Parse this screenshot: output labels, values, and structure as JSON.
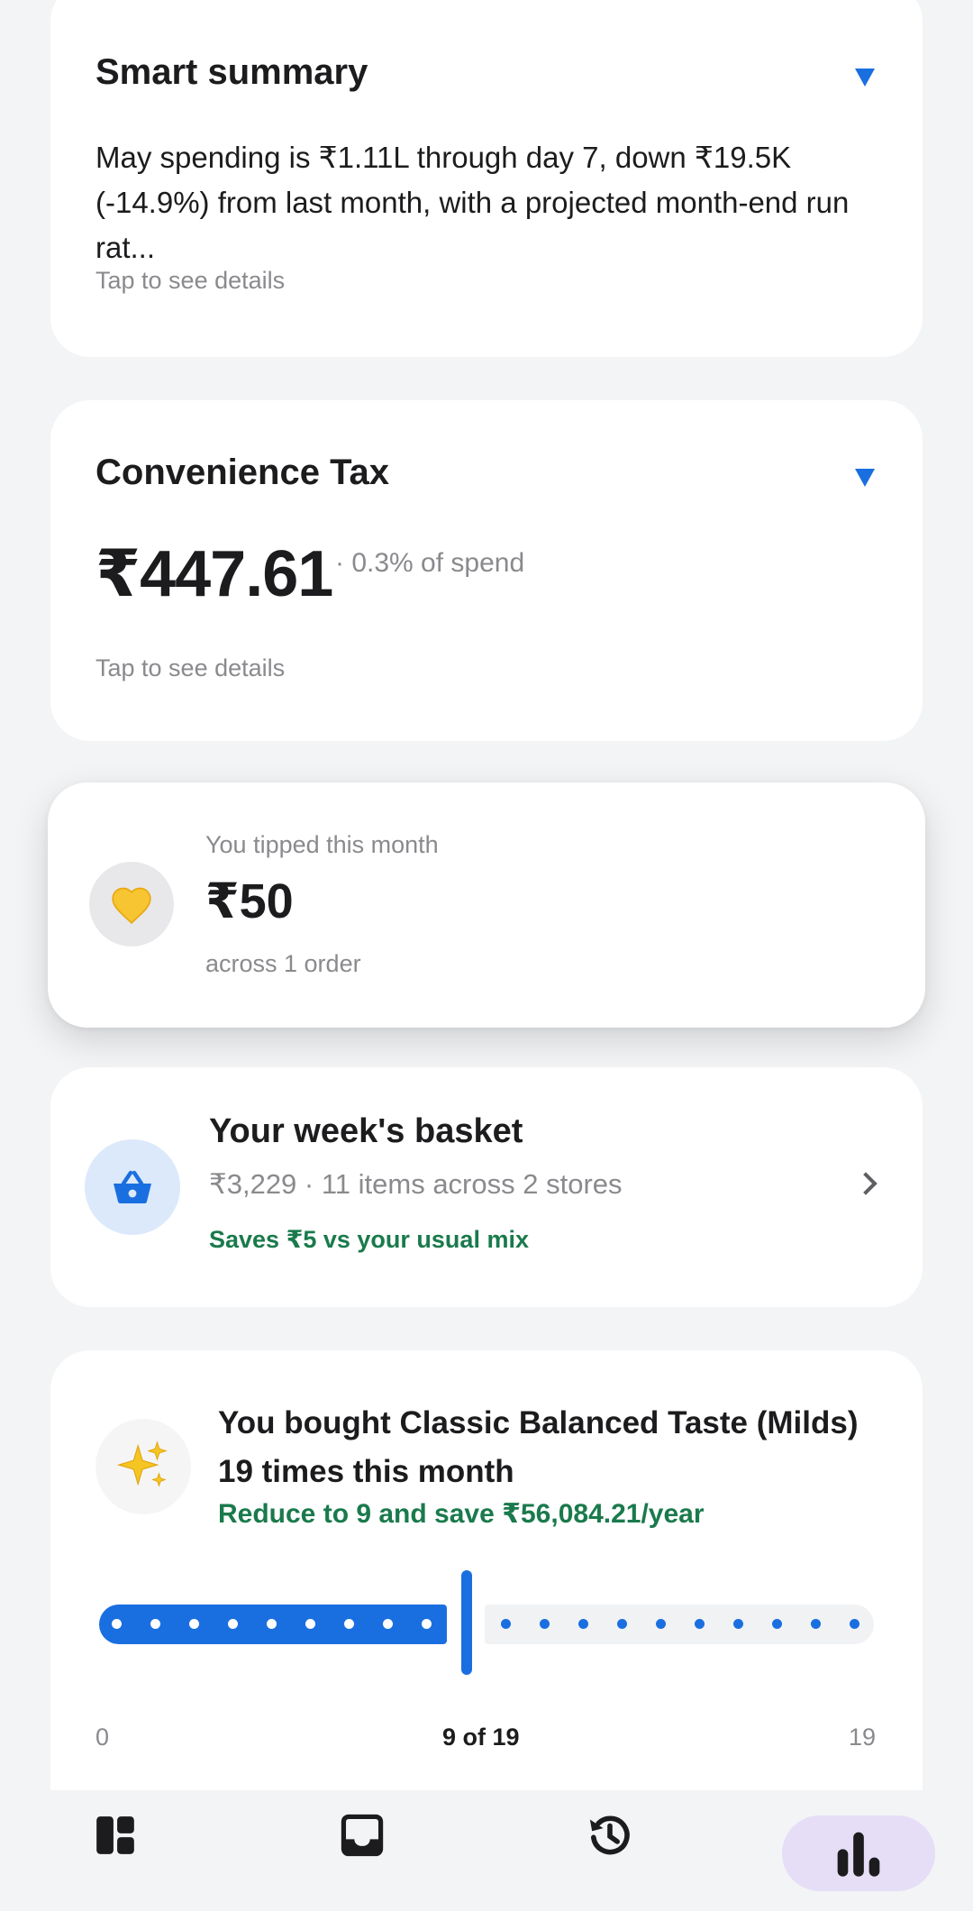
{
  "summary": {
    "title": "Smart summary",
    "text": "May spending is ₹1.11L through day 7, down ₹19.5K (-14.9%) from last month, with a projected month-end run rat...",
    "hint": "Tap to see details"
  },
  "convenience": {
    "title": "Convenience Tax",
    "amount": "₹447.61",
    "percent": "· 0.3% of spend",
    "hint": "Tap to see details"
  },
  "tips": {
    "label": "You tipped this month",
    "amount": "₹50",
    "sub": "across 1 order",
    "icon": "yellow-heart-icon"
  },
  "basket": {
    "title": "Your week's basket",
    "meta": "₹3,229 · 11 items across 2 stores",
    "savings": "Saves ₹5 vs your usual mix",
    "icon": "basket-icon"
  },
  "insight": {
    "title": "You bought Classic Balanced Taste (Milds) 19 times this month",
    "savings": "Reduce to 9 and save ₹56,084.21/year",
    "icon": "sparkles-icon",
    "slider": {
      "min_label": "0",
      "max_label": "19",
      "current_label": "9 of 19",
      "value": 9,
      "max": 19
    }
  },
  "nav": {
    "items": [
      "dashboard-icon",
      "inbox-icon",
      "history-icon",
      "bar-chart-icon"
    ],
    "active": 3
  },
  "colors": {
    "accent": "#1a6fe0",
    "savings_green": "#1a7a4c",
    "active_nav_bg": "#e6def7"
  }
}
